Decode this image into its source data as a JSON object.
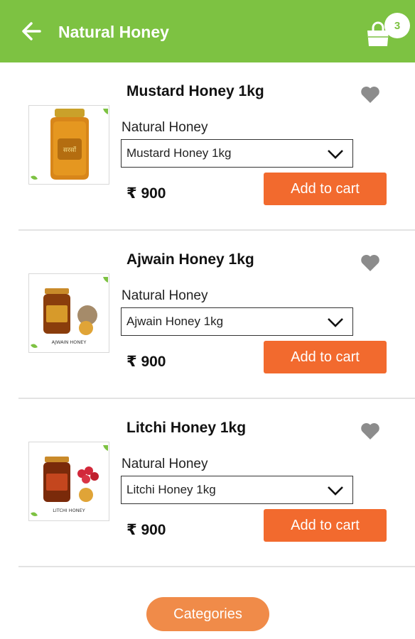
{
  "app_bar": {
    "title": "Natural Honey",
    "cart_count": "3",
    "color": "#7dc242"
  },
  "products": [
    {
      "name": "Mustard Honey 1kg",
      "brand": "Natural Honey",
      "variant": "Mustard Honey 1kg",
      "price": "₹ 900",
      "add_label": "Add to cart",
      "label_text": "सरसों"
    },
    {
      "name": "Ajwain Honey 1kg",
      "brand": "Natural Honey",
      "variant": "Ajwain Honey 1kg",
      "price": "₹ 900",
      "add_label": "Add to cart",
      "label_text": "AJWAIN HONEY"
    },
    {
      "name": "Litchi Honey 1kg",
      "brand": "Natural Honey",
      "variant": "Litchi Honey 1kg",
      "price": "₹ 900",
      "add_label": "Add to cart",
      "label_text": "LITCHI HONEY"
    }
  ],
  "bottom": {
    "categories_label": "Categories"
  },
  "icons": {
    "back": "arrow-left-icon",
    "cart": "shopping-bag-icon",
    "favorite": "heart-icon",
    "dropdown": "chevron-down-icon"
  },
  "colors": {
    "accent_orange": "#f26a2e",
    "categories_orange": "#f08b49",
    "heart_grey": "#8c8c8c"
  }
}
